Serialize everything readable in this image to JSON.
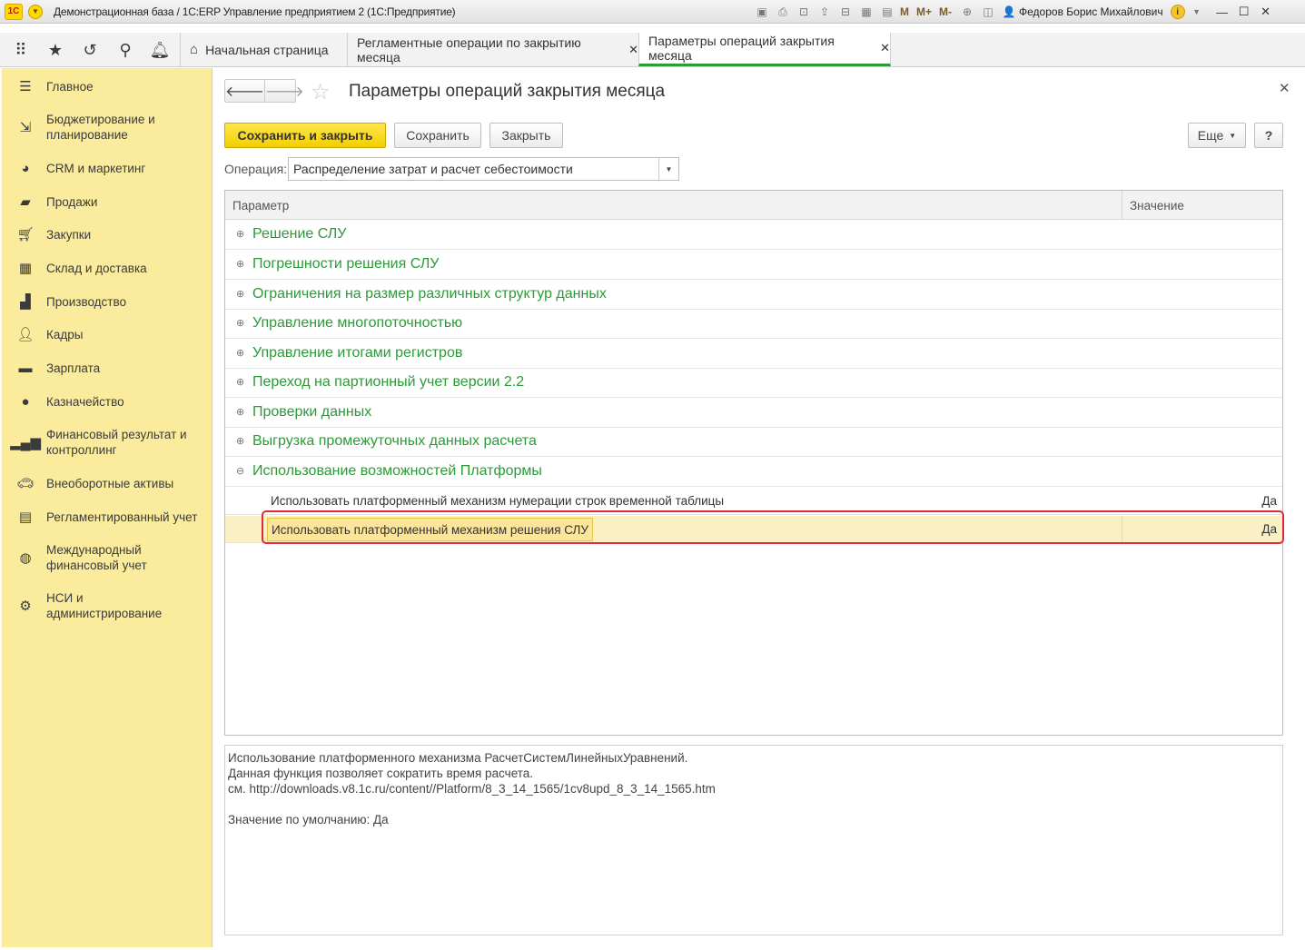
{
  "window": {
    "title": "Демонстрационная база / 1С:ERP Управление предприятием 2  (1С:Предприятие)",
    "logo": "1С",
    "user": "Федоров Борис Михайлович",
    "tools": [
      "save-icon",
      "print-icon",
      "preview-icon",
      "upload-icon",
      "scan-icon",
      "calculator-icon",
      "calendar-icon"
    ],
    "memory_buttons": [
      "M",
      "M+",
      "M-"
    ]
  },
  "tabs": [
    {
      "label": "Начальная страница",
      "closable": false
    },
    {
      "label": "Регламентные операции по закрытию месяца",
      "closable": true
    },
    {
      "label": "Параметры операций закрытия месяца",
      "closable": true,
      "active": true
    }
  ],
  "sidebar": {
    "items": [
      {
        "label": "Главное",
        "icon": "menu-lines-icon"
      },
      {
        "label": "Бюджетирование и\nпланирование",
        "icon": "budget-icon"
      },
      {
        "label": "CRM и маркетинг",
        "icon": "pie-icon"
      },
      {
        "label": "Продажи",
        "icon": "bag-icon"
      },
      {
        "label": "Закупки",
        "icon": "cart-icon"
      },
      {
        "label": "Склад и доставка",
        "icon": "warehouse-icon"
      },
      {
        "label": "Производство",
        "icon": "factory-icon"
      },
      {
        "label": "Кадры",
        "icon": "person-icon"
      },
      {
        "label": "Зарплата",
        "icon": "wallet-icon"
      },
      {
        "label": "Казначейство",
        "icon": "coin-icon"
      },
      {
        "label": "Финансовый результат и\nконтроллинг",
        "icon": "bar-chart-icon"
      },
      {
        "label": "Внеоборотные активы",
        "icon": "car-icon"
      },
      {
        "label": "Регламентированный учет",
        "icon": "calculator-icon"
      },
      {
        "label": "Международный\nфинансовый учет",
        "icon": "globe-icon"
      },
      {
        "label": "НСИ и\nадминистрирование",
        "icon": "gear-icon"
      }
    ]
  },
  "form": {
    "title": "Параметры операций закрытия месяца",
    "buttons": {
      "save_close": "Сохранить и закрыть",
      "save": "Сохранить",
      "close": "Закрыть",
      "more": "Еще",
      "help": "?"
    },
    "operation": {
      "label": "Операция:",
      "value": "Распределение затрат и расчет себестоимости"
    },
    "grid": {
      "columns": [
        "Параметр",
        "Значение"
      ],
      "groups": [
        {
          "label": "Решение СЛУ",
          "expanded": false
        },
        {
          "label": "Погрешности решения СЛУ",
          "expanded": false
        },
        {
          "label": "Ограничения на размер различных структур данных",
          "expanded": false
        },
        {
          "label": "Управление многопоточностью",
          "expanded": false
        },
        {
          "label": "Управление итогами регистров",
          "expanded": false
        },
        {
          "label": "Переход на партионный учет версии 2.2",
          "expanded": false
        },
        {
          "label": "Проверки данных",
          "expanded": false
        },
        {
          "label": "Выгрузка промежуточных данных расчета",
          "expanded": false
        },
        {
          "label": "Использование возможностей Платформы",
          "expanded": true
        }
      ],
      "children": [
        {
          "label": "Использовать платформенный механизм нумерации строк временной таблицы",
          "value": "Да"
        },
        {
          "label": "Использовать платформенный механизм решения СЛУ",
          "value": "Да",
          "selected": true
        }
      ]
    },
    "description": [
      "Использование платформенного механизма РасчетСистемЛинейныхУравнений.",
      "Данная функция позволяет сократить время расчета.",
      "см. http://downloads.v8.1c.ru/content//Platform/8_3_14_1565/1cv8upd_8_3_14_1565.htm",
      "",
      "Значение по умолчанию: Да"
    ]
  }
}
